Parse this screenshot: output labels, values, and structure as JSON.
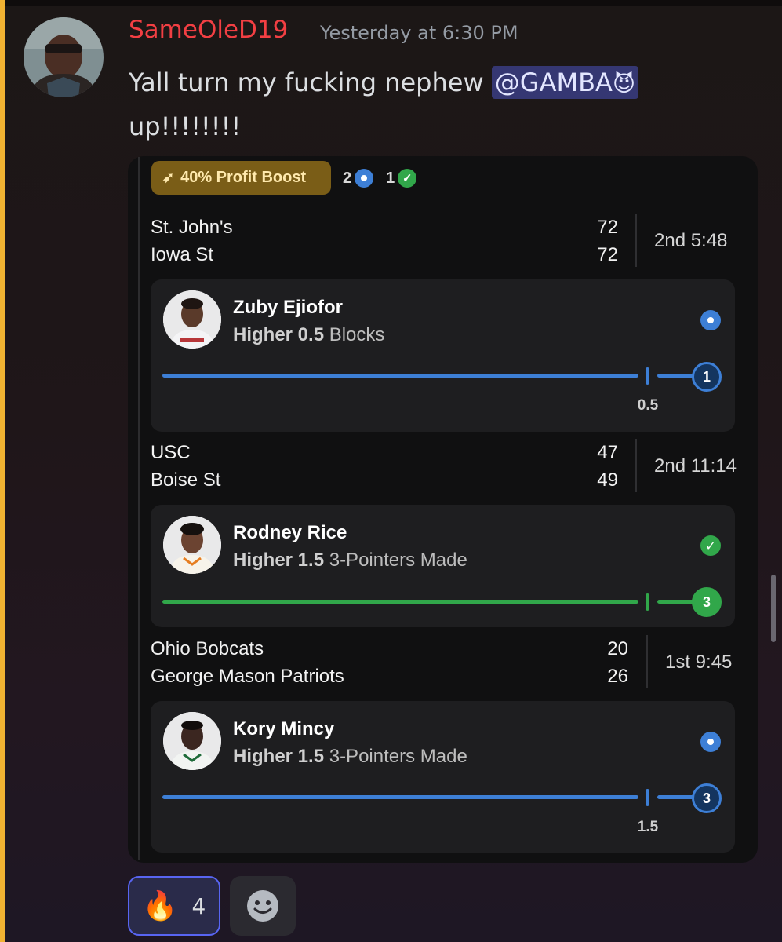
{
  "message": {
    "username": "SameOleD19",
    "timestamp": "Yesterday at 6:30 PM",
    "text_before": "Yall turn my fucking nephew ",
    "mention": "@GAMBA",
    "mention_emoji": "😈",
    "text_after": "up!!!!!!!!"
  },
  "card": {
    "boost_label": "40% Profit Boost",
    "live_count": "2",
    "won_count": "1",
    "games": [
      {
        "team1": "St. John's",
        "score1": "72",
        "team2": "Iowa St",
        "score2": "72",
        "clock": "2nd 5:48",
        "player": "Zuby Ejiofor",
        "pick": "Higher 0.5",
        "stat": "Blocks",
        "current": "1",
        "line_label": "0.5",
        "status": "live",
        "progress": 1.0
      },
      {
        "team1": "USC",
        "score1": "47",
        "team2": "Boise St",
        "score2": "49",
        "clock": "2nd 11:14",
        "player": "Rodney Rice",
        "pick": "Higher 1.5",
        "stat": "3-Pointers Made",
        "current": "3",
        "status": "won",
        "progress": 1.0
      },
      {
        "team1": "Ohio Bobcats",
        "score1": "20",
        "team2": "George Mason Patriots",
        "score2": "26",
        "clock": "1st 9:45",
        "player": "Kory Mincy",
        "pick": "Higher 1.5",
        "stat": "3-Pointers Made",
        "current": "3",
        "line_label": "1.5",
        "status": "live",
        "progress": 1.0
      }
    ]
  },
  "reactions": [
    {
      "emoji": "🔥",
      "count": "4"
    }
  ],
  "colors": {
    "username": "#f23f43",
    "live": "#3d7fd6",
    "won": "#31a74a",
    "boost_bg": "#7a5d17",
    "mention_bg": "#4a4f9c"
  }
}
